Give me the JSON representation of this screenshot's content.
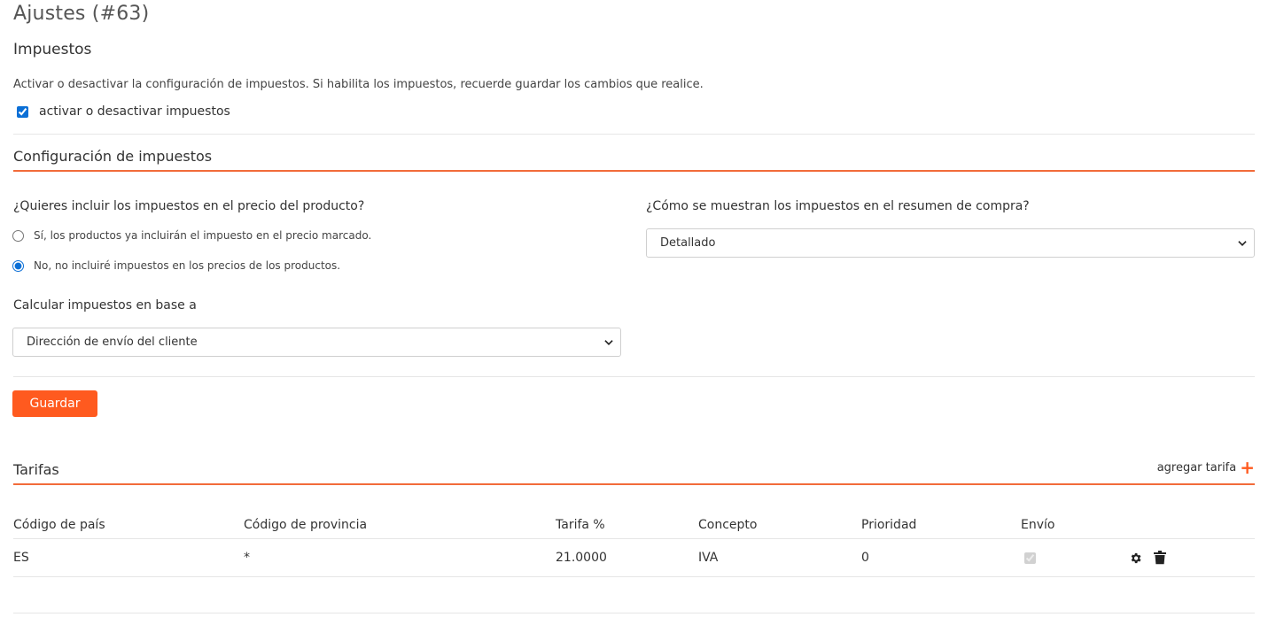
{
  "page": {
    "title": "Ajustes (#63)"
  },
  "taxes": {
    "title": "Impuestos",
    "help": "Activar o desactivar la configuración de impuestos. Si habilita los impuestos, recuerde guardar los cambios que realice.",
    "toggle_label": "activar o desactivar impuestos",
    "toggle_checked": true
  },
  "config": {
    "title": "Configuración de impuestos",
    "include_question": "¿Quieres incluir los impuestos en el precio del producto?",
    "include_options": [
      {
        "label": "Sí, los productos ya incluirán el impuesto en el precio marcado.",
        "checked": false
      },
      {
        "label": "No, no incluiré impuestos en los precios de los productos.",
        "checked": true
      }
    ],
    "display_question": "¿Cómo se muestran los impuestos en el resumen de compra?",
    "display_value": "Detallado",
    "calc_label": "Calcular impuestos en base a",
    "calc_value": "Dirección de envío del cliente",
    "save_label": "Guardar"
  },
  "rates": {
    "title": "Tarifas",
    "add_label": "agregar tarifa",
    "add_icon": "plus-icon",
    "columns": [
      "Código de país",
      "Código de provincia",
      "Tarifa %",
      "Concepto",
      "Prioridad",
      "Envío"
    ],
    "rows": [
      {
        "country": "ES",
        "province": "*",
        "rate": "21.0000",
        "concept": "IVA",
        "priority": "0",
        "shipping": true
      }
    ],
    "row_icons": [
      "gear-icon",
      "trash-icon"
    ]
  },
  "colors": {
    "accent": "#ff5a1f",
    "accent_line": "#f26b3a",
    "checkbox": "#0b6fd6"
  }
}
